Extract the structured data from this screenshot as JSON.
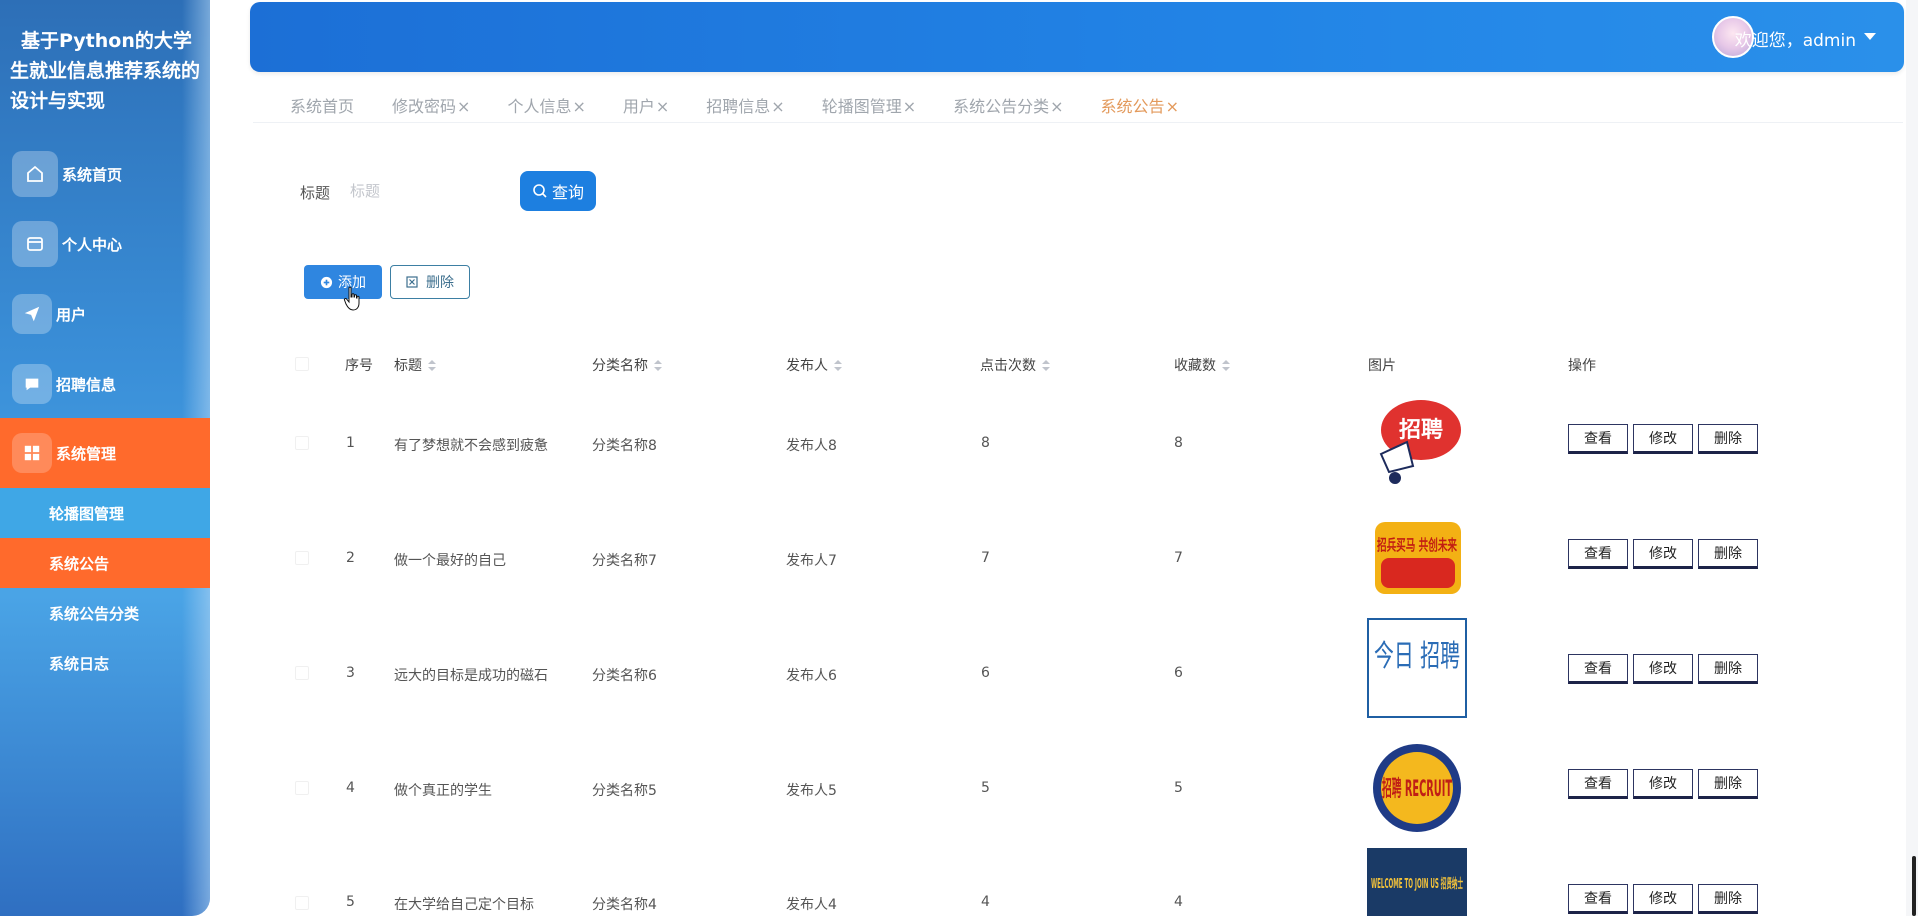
{
  "brand": {
    "title": "基于Python的大学生就业信息推荐系统的设计与实现"
  },
  "sidebar": {
    "items": [
      {
        "label": "系统首页",
        "icon": "home-icon"
      },
      {
        "label": "个人中心",
        "icon": "card-icon"
      },
      {
        "label": "用户",
        "icon": "paper-plane-icon"
      },
      {
        "label": "招聘信息",
        "icon": "chat-icon"
      },
      {
        "label": "系统管理",
        "icon": "grid-icon"
      }
    ],
    "sub_items": [
      {
        "label": "轮播图管理"
      },
      {
        "label": "系统公告"
      },
      {
        "label": "系统公告分类"
      },
      {
        "label": "系统日志"
      }
    ]
  },
  "header": {
    "welcome": "欢迎您，admin"
  },
  "tabs": [
    {
      "label": "系统首页",
      "close": ""
    },
    {
      "label": "修改密码",
      "close": "×"
    },
    {
      "label": "个人信息",
      "close": "×"
    },
    {
      "label": "用户",
      "close": "×"
    },
    {
      "label": "招聘信息",
      "close": "×"
    },
    {
      "label": "轮播图管理",
      "close": "×"
    },
    {
      "label": "系统公告分类",
      "close": "×"
    },
    {
      "label": "系统公告",
      "close": "×"
    }
  ],
  "search": {
    "label": "标题",
    "placeholder": "标题",
    "button": "查询"
  },
  "actions": {
    "add": "添加",
    "delete": "删除"
  },
  "table": {
    "headers": {
      "index": "序号",
      "title": "标题",
      "category": "分类名称",
      "publisher": "发布人",
      "clicks": "点击次数",
      "favorites": "收藏数",
      "image": "图片",
      "ops": "操作"
    },
    "op_labels": {
      "view": "查看",
      "edit": "修改",
      "delete": "删除"
    },
    "rows": [
      {
        "index": "1",
        "title": "有了梦想就不会感到疲惫",
        "category": "分类名称8",
        "publisher": "发布人8",
        "clicks": "8",
        "favorites": "8",
        "image_text": "招聘"
      },
      {
        "index": "2",
        "title": "做一个最好的自己",
        "category": "分类名称7",
        "publisher": "发布人7",
        "clicks": "7",
        "favorites": "7",
        "image_text": "招兵买马 共创未来"
      },
      {
        "index": "3",
        "title": "远大的目标是成功的磁石",
        "category": "分类名称6",
        "publisher": "发布人6",
        "clicks": "6",
        "favorites": "6",
        "image_text": "今日 招聘"
      },
      {
        "index": "4",
        "title": "做个真正的学生",
        "category": "分类名称5",
        "publisher": "发布人5",
        "clicks": "5",
        "favorites": "5",
        "image_text": "招聘 RECRUIT"
      },
      {
        "index": "5",
        "title": "在大学给自己定个目标",
        "category": "分类名称4",
        "publisher": "发布人4",
        "clicks": "4",
        "favorites": "4",
        "image_text": "WELCOME TO JOIN US 招贤纳士"
      }
    ]
  }
}
